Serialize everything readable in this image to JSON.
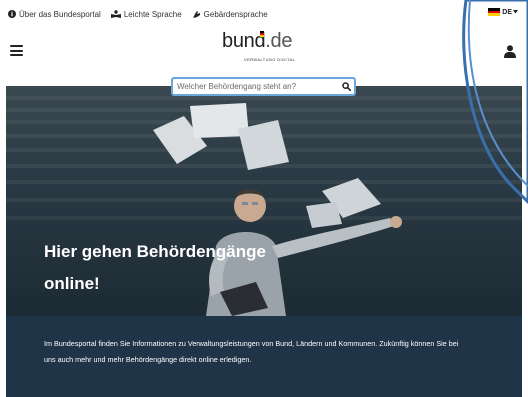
{
  "utility": {
    "about_label": "Über das Bundesportal",
    "easy_language_label": "Leichte Sprache",
    "sign_language_label": "Gebärdensprache",
    "language_code": "DE"
  },
  "header": {
    "logo_word": "bund",
    "logo_tld": ".de",
    "logo_subtitle": "VERWALTUNG DIGITAL"
  },
  "search": {
    "placeholder": "Welcher Behördengang steht an?"
  },
  "hero": {
    "headline_line1": "Hier gehen Behördengänge",
    "headline_line2": "online!"
  },
  "intro": {
    "text": "Im Bundesportal finden Sie Informationen zu Verwaltungsleistungen von Bund, Ländern und Kommunen. Zukünftig können Sie bei uns auch mehr und mehr Behördengänge direkt online erledigen."
  },
  "colors": {
    "search_border": "#6aa7dc",
    "intro_background": "#1f3447",
    "loop_stroke": "#3a6fae"
  }
}
